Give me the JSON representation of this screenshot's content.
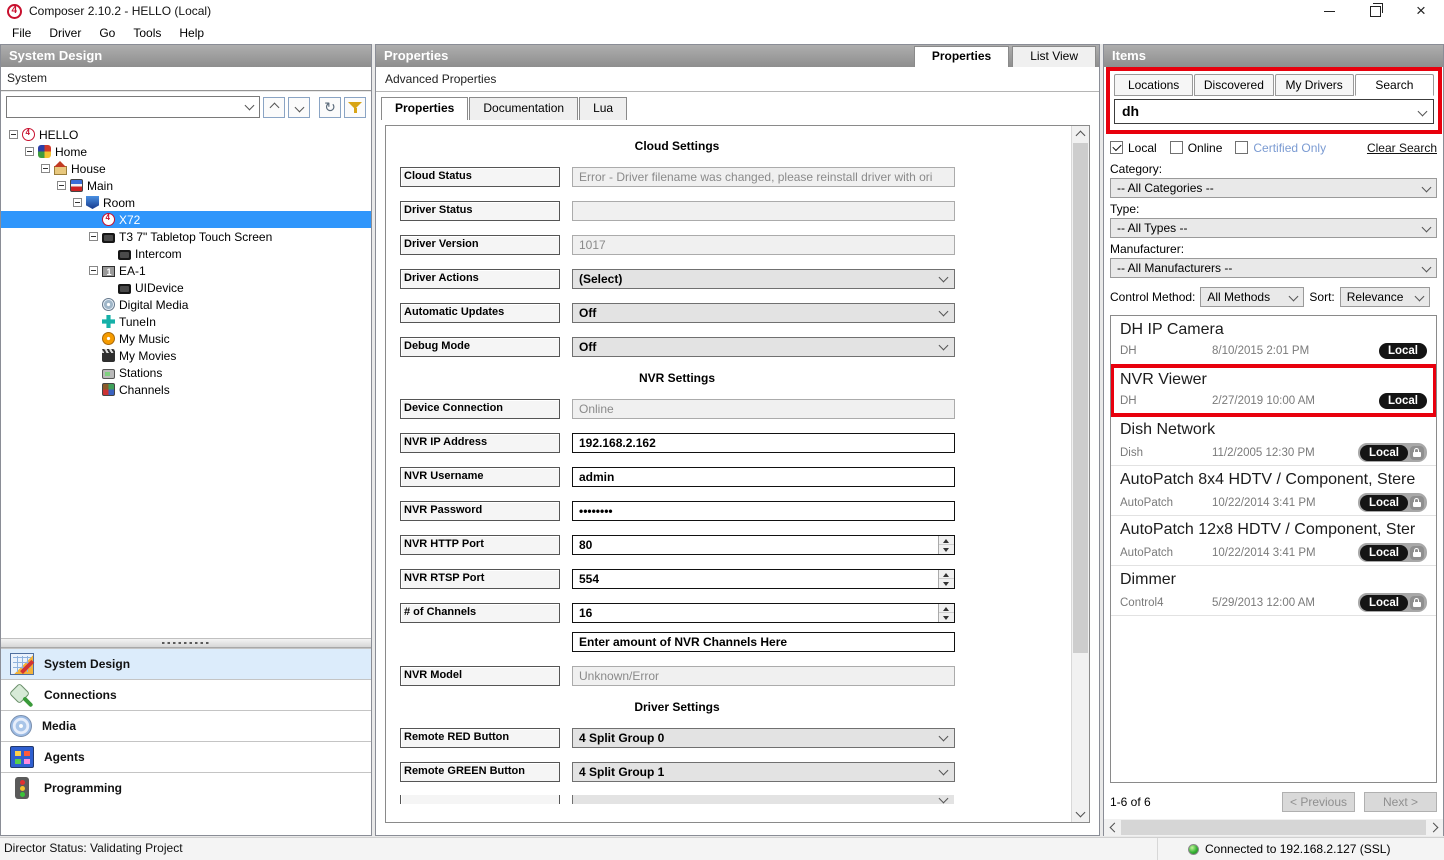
{
  "colors": {
    "header_gray": "#9c9c9c",
    "selection_blue": "#2f96fb",
    "annotation_red": "#e8000d",
    "badge_black": "#141414",
    "status_green": "#34b233",
    "certified_blue": "#7b9bd2"
  },
  "window": {
    "title": "Composer 2.10.2 - HELLO (Local)",
    "control_icons": [
      "minimize-icon",
      "maximize-icon",
      "close-icon"
    ],
    "logo_icon": "control4-logo"
  },
  "menu": [
    {
      "label": "File"
    },
    {
      "label": "Driver"
    },
    {
      "label": "Go"
    },
    {
      "label": "Tools"
    },
    {
      "label": "Help"
    }
  ],
  "system_design": {
    "header": "System Design",
    "system_label": "System",
    "filter_combo_value": "",
    "toolbar_icons": [
      "chevron-up-icon",
      "chevron-down-icon",
      "refresh-icon",
      "filter-funnel-icon"
    ],
    "tree": [
      {
        "label": "HELLO",
        "icon": "c4",
        "depth": 0,
        "expand": true
      },
      {
        "label": "Home",
        "icon": "home",
        "depth": 1,
        "expand": true
      },
      {
        "label": "House",
        "icon": "house",
        "depth": 2,
        "expand": true
      },
      {
        "label": "Main",
        "icon": "main",
        "depth": 3,
        "expand": true
      },
      {
        "label": "Room",
        "icon": "room",
        "depth": 4,
        "expand": true
      },
      {
        "label": "X72",
        "icon": "c4",
        "depth": 5,
        "selected": true
      },
      {
        "label": "T3 7\" Tabletop Touch Screen",
        "icon": "screen",
        "depth": 5,
        "expand": true
      },
      {
        "label": "Intercom",
        "icon": "screen",
        "depth": 6
      },
      {
        "label": "EA-1",
        "icon": "ea1",
        "depth": 5,
        "expand": true
      },
      {
        "label": "UIDevice",
        "icon": "screen",
        "depth": 6
      },
      {
        "label": "Digital Media",
        "icon": "cd",
        "depth": 5
      },
      {
        "label": "TuneIn",
        "icon": "tunein",
        "depth": 5
      },
      {
        "label": "My Music",
        "icon": "music",
        "depth": 5
      },
      {
        "label": "My Movies",
        "icon": "movies",
        "depth": 5
      },
      {
        "label": "Stations",
        "icon": "stations",
        "depth": 5
      },
      {
        "label": "Channels",
        "icon": "channels",
        "depth": 5
      }
    ],
    "nav": [
      {
        "label": "System Design",
        "icon": "system-design",
        "active": true
      },
      {
        "label": "Connections",
        "icon": "connections"
      },
      {
        "label": "Media",
        "icon": "media"
      },
      {
        "label": "Agents",
        "icon": "agents"
      },
      {
        "label": "Programming",
        "icon": "programming"
      }
    ]
  },
  "properties_panel": {
    "header": "Properties",
    "header_tabs": [
      {
        "label": "Properties",
        "active": true
      },
      {
        "label": "List View"
      }
    ],
    "subheader": "Advanced Properties",
    "tabs": [
      {
        "label": "Properties",
        "active": true
      },
      {
        "label": "Documentation"
      },
      {
        "label": "Lua"
      }
    ],
    "rows": [
      {
        "type": "section",
        "label": "Cloud Settings",
        "value": ""
      },
      {
        "type": "readonly",
        "label": "Cloud Status",
        "value": "Error - Driver filename was changed, please reinstall driver with ori"
      },
      {
        "type": "readonly",
        "label": "Driver Status",
        "value": ""
      },
      {
        "type": "readonly",
        "label": "Driver Version",
        "value": "1017"
      },
      {
        "type": "select",
        "label": "Driver Actions",
        "value": "(Select)"
      },
      {
        "type": "select",
        "label": "Automatic Updates",
        "value": "Off"
      },
      {
        "type": "select",
        "label": "Debug Mode",
        "value": "Off"
      },
      {
        "type": "section",
        "label": "NVR Settings",
        "value": ""
      },
      {
        "type": "readonly",
        "label": "Device Connection",
        "value": "Online"
      },
      {
        "type": "text",
        "label": "NVR IP Address",
        "value": "192.168.2.162"
      },
      {
        "type": "text",
        "label": "NVR Username",
        "value": "admin"
      },
      {
        "type": "text",
        "label": "NVR Password",
        "value": "••••••••"
      },
      {
        "type": "spinner",
        "label": "NVR HTTP Port",
        "value": "80"
      },
      {
        "type": "spinner",
        "label": "NVR RTSP Port",
        "value": "554"
      },
      {
        "type": "spinner",
        "label": "# of Channels",
        "value": "16"
      },
      {
        "type": "helper",
        "label": "",
        "value": "Enter amount of NVR Channels Here"
      },
      {
        "type": "readonly",
        "label": "NVR Model",
        "value": "Unknown/Error"
      },
      {
        "type": "section",
        "label": "Driver Settings",
        "value": ""
      },
      {
        "type": "select",
        "label": "Remote RED Button",
        "value": "4 Split Group 0"
      },
      {
        "type": "select",
        "label": "Remote GREEN Button",
        "value": "4 Split Group 1"
      },
      {
        "type": "partial",
        "label": "",
        "value": ""
      }
    ]
  },
  "items_panel": {
    "header": "Items",
    "tabs": [
      {
        "label": "Locations"
      },
      {
        "label": "Discovered"
      },
      {
        "label": "My Drivers"
      },
      {
        "label": "Search",
        "active": true
      }
    ],
    "search_value": "dh",
    "checkboxes": [
      {
        "label": "Local",
        "checked": true
      },
      {
        "label": "Online"
      },
      {
        "label": "Certified Only",
        "blue": true
      }
    ],
    "clear_search": "Clear Search",
    "category_label": "Category:",
    "category_value": "-- All Categories --",
    "type_label": "Type:",
    "type_value": "-- All Types --",
    "manufacturer_label": "Manufacturer:",
    "manufacturer_value": "-- All Manufacturers --",
    "control_method_label": "Control Method:",
    "control_method_value": "All Methods",
    "sort_label": "Sort:",
    "sort_value": "Relevance",
    "results": [
      {
        "name": "DH IP Camera",
        "vendor": "DH",
        "date": "8/10/2015 2:01 PM",
        "badge": "Local"
      },
      {
        "name": "NVR Viewer",
        "vendor": "DH",
        "date": "2/27/2019 10:00 AM",
        "badge": "Local",
        "annotated": true
      },
      {
        "name": "Dish Network",
        "vendor": "Dish",
        "date": "11/2/2005 12:30 PM",
        "badge": "Local",
        "lock": true
      },
      {
        "name": "AutoPatch 8x4 HDTV / Component, Stere",
        "vendor": "AutoPatch",
        "date": "10/22/2014 3:41 PM",
        "badge": "Local",
        "lock": true
      },
      {
        "name": "AutoPatch 12x8 HDTV / Component, Ster",
        "vendor": "AutoPatch",
        "date": "10/22/2014 3:41 PM",
        "badge": "Local",
        "lock": true
      },
      {
        "name": "Dimmer",
        "vendor": "Control4",
        "date": "5/29/2013 12:00 AM",
        "badge": "Local",
        "lock": true
      }
    ],
    "pagination": {
      "count": "1-6 of 6",
      "prev": "< Previous",
      "next": "Next >"
    }
  },
  "status_bar": {
    "director": "Director Status: Validating Project",
    "connection": "Connected to 192.168.2.127 (SSL)"
  }
}
